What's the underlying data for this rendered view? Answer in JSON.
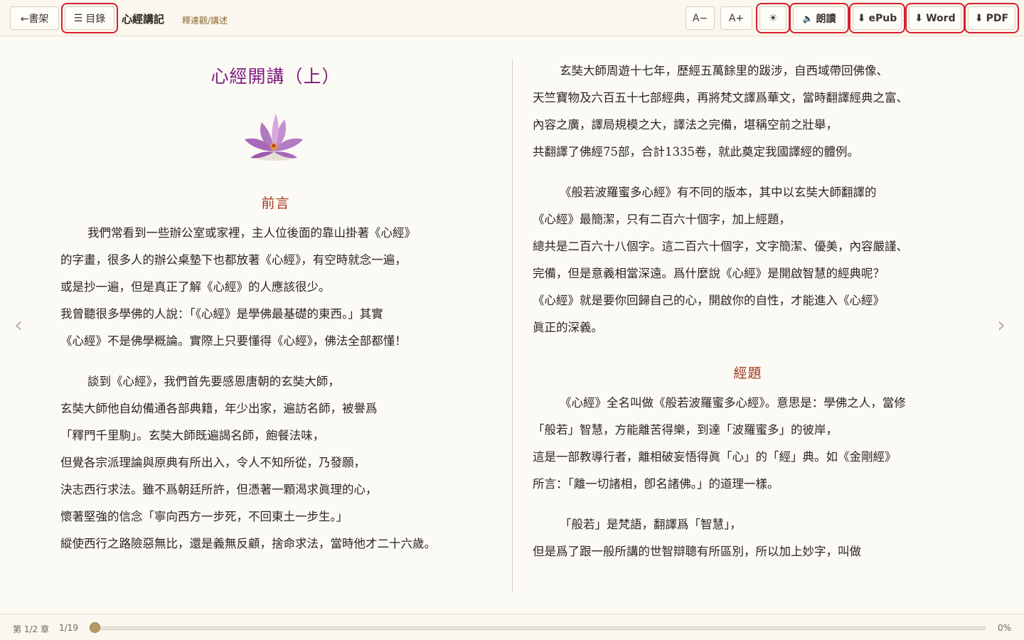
{
  "toolbar": {
    "back_label": "←書架",
    "toc_label": "目錄",
    "book_title": "心經講記",
    "author": "釋達觀/講述",
    "font_smaller": "A−",
    "font_larger": "A+",
    "theme_icon": "☀",
    "read_aloud": "朗讀",
    "epub": "ePub",
    "word": "Word",
    "pdf": "PDF"
  },
  "left_page": {
    "chapter_title": "心經開講（上）",
    "heading": "前言",
    "lines": [
      "我們常看到一些辦公室或家裡，主人位後面的靠山掛著《心經》",
      "的字畫，很多人的辦公桌墊下也都放著《心經》，有空時就念一遍，",
      "或是抄一遍，但是真正了解《心經》的人應該很少。",
      "我曾聽很多學佛的人說：「《心經》是學佛最基礎的東西。」其實",
      "《心經》不是佛學概論。實際上只要懂得《心經》，佛法全部都懂！",
      "談到《心經》，我們首先要感恩唐朝的玄奘大師，",
      "玄奘大師他自幼備通各部典籍，年少出家，遍訪名師，被譽爲",
      "「釋門千里駒」。玄奘大師既遍謁名師，飽餐法味，",
      "但覺各宗派理論與原典有所出入，令人不知所從，乃發願，",
      "決志西行求法。雖不爲朝廷所許，但憑著一顆渴求眞理的心，",
      "懷著堅強的信念「寧向西方一步死，不回東土一步生。」",
      "縱使西行之路險惡無比，還是義無反顧，捨命求法，當時他才二十六歲。"
    ]
  },
  "right_page": {
    "lines": [
      "玄奘大師周遊十七年，歷經五萬餘里的跋涉，自西域帶回佛像、",
      "天竺寶物及六百五十七部經典，再將梵文譯爲華文，當時翻譯經典之富、",
      "內容之廣，譯局規模之大，譯法之完備，堪稱空前之壯舉，",
      "共翻譯了佛經75部，合計1335卷，就此奠定我國譯經的體例。",
      "《般若波羅蜜多心經》有不同的版本，其中以玄奘大師翻譯的",
      "《心經》最簡潔，只有二百六十個字，加上經題，",
      "總共是二百六十八個字。這二百六十個字，文字簡潔、優美，內容嚴謹、",
      "完備，但是意義相當深遠。爲什麼說《心經》是開啟智慧的經典呢？",
      "《心經》就是要你回歸自己的心，開啟你的自性，才能進入《心經》",
      "眞正的深義。",
      "《心經》全名叫做《般若波羅蜜多心經》。意思是：學佛之人，當修",
      "「般若」智慧，方能離苦得樂，到達「波羅蜜多」的彼岸，",
      "這是一部教導行者，離相破妄悟得眞「心」的「經」典。如《金剛經》",
      "所言：「離一切諸相，卽名諸佛。」的道理一樣。",
      "「般若」是梵語，翻譯爲「智慧」，",
      "但是爲了跟一般所講的世智辯聰有所區別，所以加上妙字，叫做"
    ],
    "heading": "經題"
  },
  "nav": {
    "prev": "‹",
    "next": "›"
  },
  "footer": {
    "chapter": "第 1/2 章",
    "page": "1/19",
    "percent": "0%",
    "progress": 0
  },
  "colors": {
    "title": "#7d1a7d",
    "heading": "#a3361a",
    "highlight": "#d6202e"
  }
}
